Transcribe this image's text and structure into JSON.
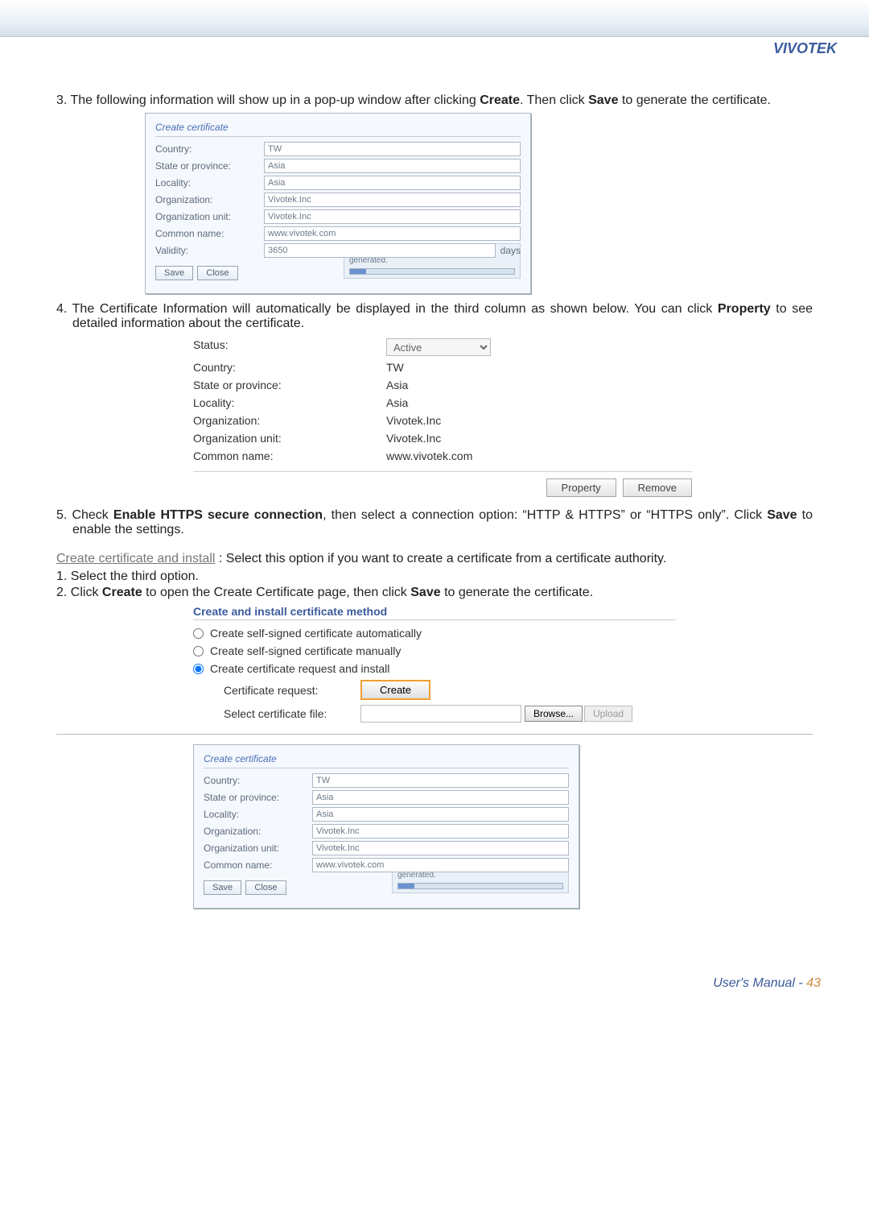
{
  "brand": "VIVOTEK",
  "step3": {
    "num": "3. ",
    "text_a": "The following information will show up in a pop-up window after clicking ",
    "kw_create": "Create",
    "text_b": ". Then click ",
    "kw_save": "Save",
    "text_c": " to generate the certificate."
  },
  "popupA": {
    "legend": "Create certificate",
    "fields": {
      "country_l": "Country:",
      "country_v": "TW",
      "state_l": "State or province:",
      "state_v": "Asia",
      "locality_l": "Locality:",
      "locality_v": "Asia",
      "org_l": "Organization:",
      "org_v": "Vivotek.Inc",
      "orgu_l": "Organization unit:",
      "orgu_v": "Vivotek.Inc",
      "cn_l": "Common name:",
      "cn_v": "www.vivotek.com",
      "validity_l": "Validity:",
      "validity_v": "3650",
      "validity_days": "days"
    },
    "save": "Save",
    "close": "Close",
    "wait": "Please wait while the certificate is being generated."
  },
  "step4": {
    "num": "4. ",
    "text_a": "The Certificate Information will automatically be displayed in the third column as shown below. You can click ",
    "kw": "Property",
    "text_b": " to see detailed information about the certificate."
  },
  "certinfo": {
    "status_l": "Status:",
    "status_v": "Active",
    "country_l": "Country:",
    "country_v": "TW",
    "state_l": "State or province:",
    "state_v": "Asia",
    "locality_l": "Locality:",
    "locality_v": "Asia",
    "org_l": "Organization:",
    "org_v": "Vivotek.Inc",
    "orgu_l": "Organization unit:",
    "orgu_v": "Vivotek.Inc",
    "cn_l": "Common name:",
    "cn_v": "www.vivotek.com",
    "property_btn": "Property",
    "remove_btn": "Remove"
  },
  "step5": {
    "num": "5. ",
    "text_a": "Check ",
    "kw1": "Enable HTTPS secure connection",
    "text_b": ", then select a connection option: “HTTP & HTTPS” or “HTTPS only”. Click ",
    "kw2": "Save",
    "text_c": " to enable the settings."
  },
  "create_install_heading": "Create certificate and install",
  "create_install_tail": " :  Select this option if you want to create a certificate from a certificate authority.",
  "sub1": "1. Select the third option.",
  "sub2": {
    "num": "2. ",
    "a": "Click ",
    "kw1": "Create",
    "b": " to open the Create Certificate page, then click ",
    "kw2": "Save",
    "c": " to generate the certificate."
  },
  "method": {
    "legend": "Create and install certificate method",
    "opt1": "Create self-signed certificate automatically",
    "opt2": "Create self-signed certificate manually",
    "opt3": "Create certificate request and install",
    "certreq_l": "Certificate request:",
    "create_btn": "Create",
    "selfile_l": "Select certificate file:",
    "browse_btn": "Browse...",
    "upload_btn": "Upload"
  },
  "popupB": {
    "legend": "Create certificate",
    "fields": {
      "country_l": "Country:",
      "country_v": "TW",
      "state_l": "State or province:",
      "state_v": "Asia",
      "locality_l": "Locality:",
      "locality_v": "Asia",
      "org_l": "Organization:",
      "org_v": "Vivotek.Inc",
      "orgu_l": "Organization unit:",
      "orgu_v": "Vivotek.Inc",
      "cn_l": "Common name:",
      "cn_v": "www.vivotek.com"
    },
    "save": "Save",
    "close": "Close",
    "wait": "Please wait while the certificate is being generated."
  },
  "footer": {
    "um": "User's Manual - ",
    "page": "43"
  }
}
